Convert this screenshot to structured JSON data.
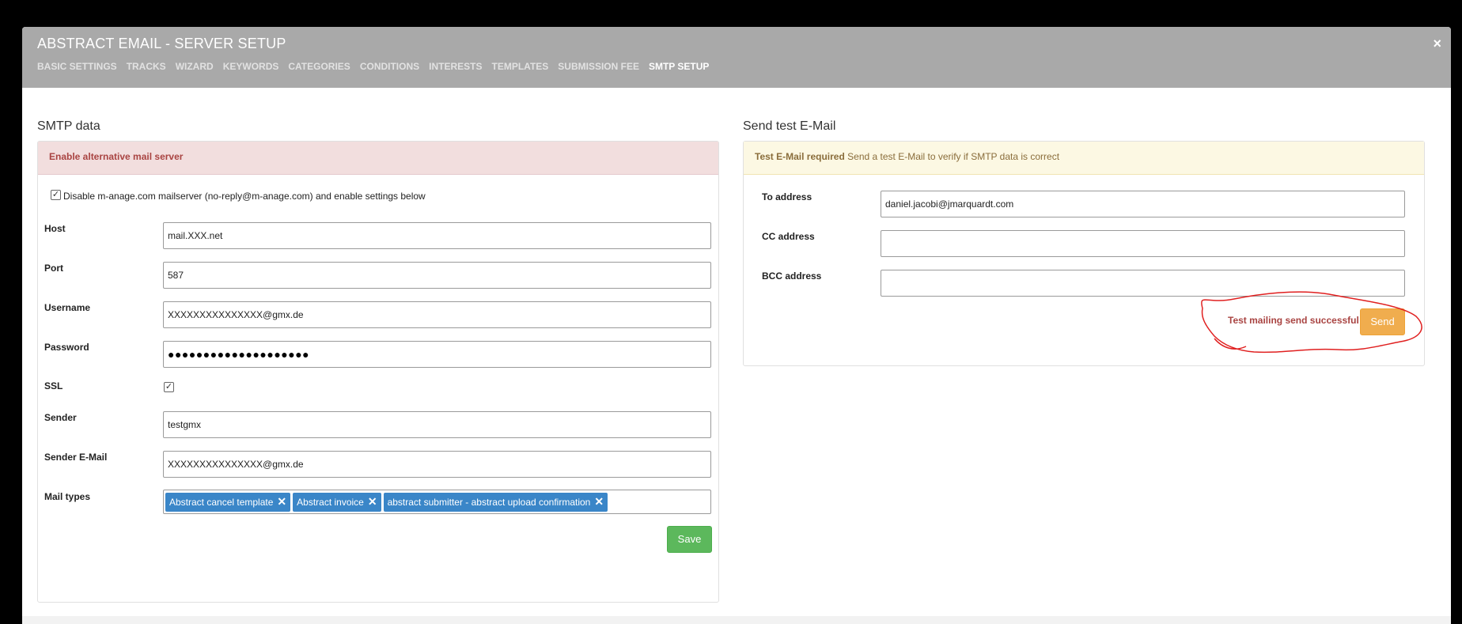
{
  "modal": {
    "title": "ABSTRACT EMAIL - SERVER SETUP",
    "close_label": "×",
    "tabs": [
      {
        "label": "BASIC SETTINGS"
      },
      {
        "label": "TRACKS"
      },
      {
        "label": "WIZARD"
      },
      {
        "label": "KEYWORDS"
      },
      {
        "label": "CATEGORIES"
      },
      {
        "label": "CONDITIONS"
      },
      {
        "label": "INTERESTS"
      },
      {
        "label": "TEMPLATES"
      },
      {
        "label": "SUBMISSION FEE"
      },
      {
        "label": "SMTP SETUP",
        "active": true
      }
    ]
  },
  "smtp": {
    "section_title": "SMTP data",
    "panel_heading": "Enable alternative mail server",
    "disable_checkbox_label": "Disable m-anage.com mailserver (no-reply@m-anage.com) and enable settings below",
    "disable_checked": true,
    "host": {
      "label": "Host",
      "value": "mail.XXX.net"
    },
    "port": {
      "label": "Port",
      "value": "587"
    },
    "username": {
      "label": "Username",
      "value": "XXXXXXXXXXXXXXX@gmx.de"
    },
    "password": {
      "label": "Password",
      "value": "●●●●●●●●●●●●●●●●●●●●"
    },
    "ssl": {
      "label": "SSL",
      "checked": true
    },
    "sender": {
      "label": "Sender",
      "value": "testgmx"
    },
    "sender_email": {
      "label": "Sender E-Mail",
      "value": "XXXXXXXXXXXXXXX@gmx.de"
    },
    "mail_types": {
      "label": "Mail types",
      "tags": [
        {
          "label": "Abstract cancel template"
        },
        {
          "label": "Abstract invoice"
        },
        {
          "label": "abstract submitter - abstract upload confirmation"
        }
      ]
    },
    "save_label": "Save"
  },
  "test_email": {
    "section_title": "Send test E-Mail",
    "warning_bold": "Test E-Mail required",
    "warning_text": "Send a test E-Mail to verify if SMTP data is correct",
    "to": {
      "label": "To address",
      "value": "daniel.jacobi@jmarquardt.com"
    },
    "cc": {
      "label": "CC address",
      "value": ""
    },
    "bcc": {
      "label": "BCC address",
      "value": ""
    },
    "success_message": "Test mailing send successful",
    "send_label": "Send"
  },
  "icons": {
    "close": "close-icon",
    "check": "checkmark-icon",
    "remove_tag": "remove-x-icon"
  },
  "colors": {
    "header_bg": "#a9a9a9",
    "danger_bg": "#f2dede",
    "danger_text": "#a94442",
    "warning_bg": "#fcf8e3",
    "tag_bg": "#3a86c8",
    "save_btn": "#5cb85c",
    "send_btn": "#f0ad4e",
    "annotation": "#e02020"
  }
}
